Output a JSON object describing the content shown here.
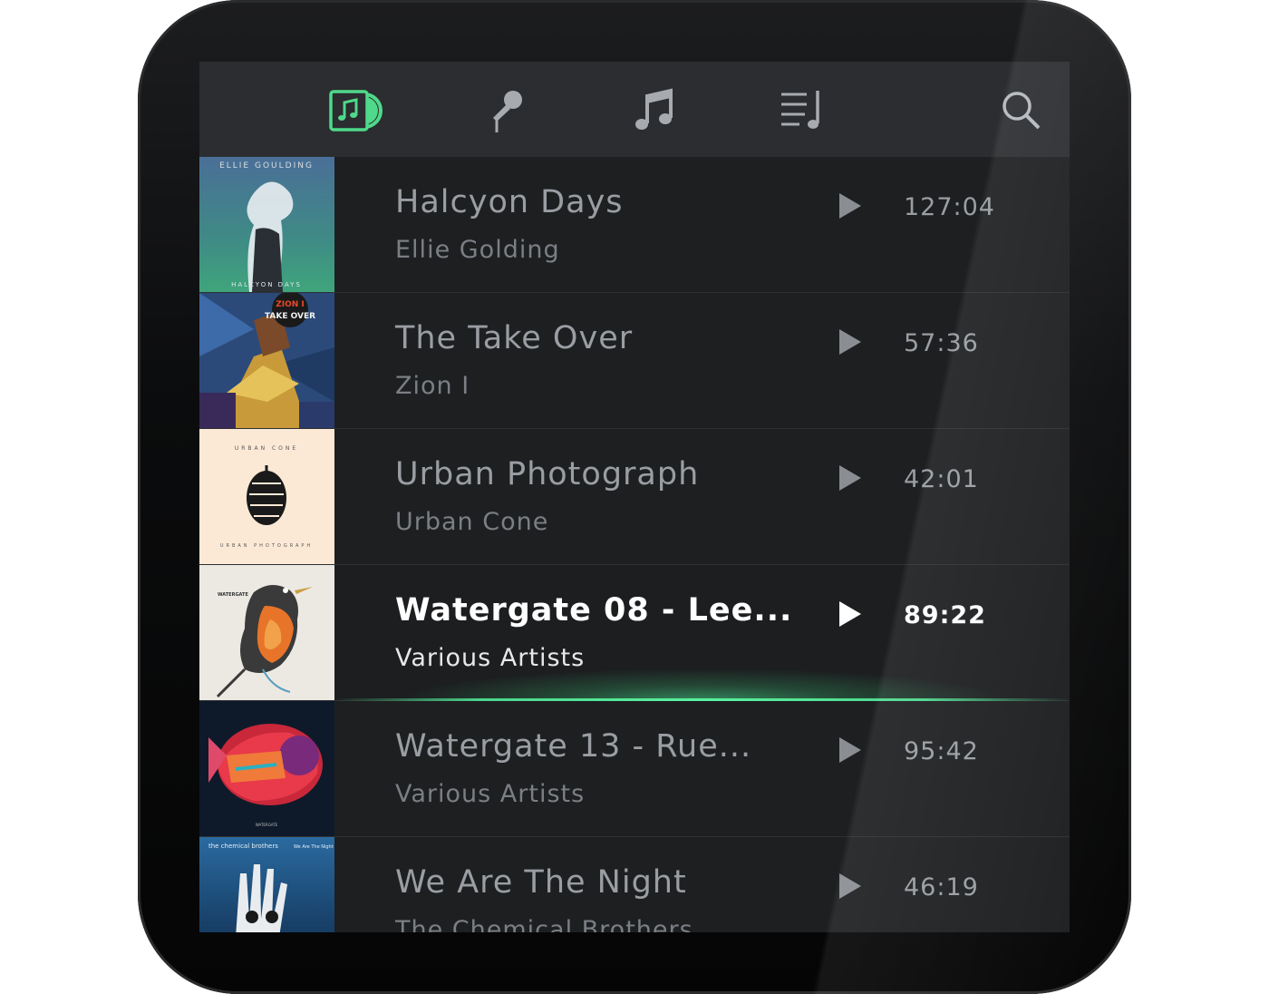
{
  "nav": {
    "tabs": [
      {
        "name": "albums",
        "icon": "album-note-icon",
        "active": true
      },
      {
        "name": "artists",
        "icon": "microphone-icon",
        "active": false
      },
      {
        "name": "songs",
        "icon": "music-note-icon",
        "active": false
      },
      {
        "name": "playlists",
        "icon": "playlist-icon",
        "active": false
      }
    ],
    "search_icon": "search-icon"
  },
  "colors": {
    "accent": "#4fd98a",
    "background": "#1d1f21",
    "navbar": "#2b2d30",
    "text_muted": "#9a9ea3",
    "text_active": "#ffffff"
  },
  "albums": [
    {
      "title": "Halcyon Days",
      "artist": "Ellie Golding",
      "duration": "127:04",
      "art_text": [
        "ELLIE GOULDING",
        "HALCYON DAYS"
      ],
      "active": false
    },
    {
      "title": "The Take Over",
      "artist": "Zion I",
      "duration": "57:36",
      "art_text": [
        "ZION I",
        "TAKE OVER"
      ],
      "active": false
    },
    {
      "title": "Urban Photograph",
      "artist": "Urban Cone",
      "duration": "42:01",
      "art_text": [
        "URBAN CONE",
        "URBAN PHOTOGRAPH"
      ],
      "active": false
    },
    {
      "title": "Watergate 08 - Lee...",
      "artist": "Various Artists",
      "duration": "89:22",
      "art_text": [
        "WATERGATE"
      ],
      "active": true
    },
    {
      "title": "Watergate 13 - Rue...",
      "artist": "Various Artists",
      "duration": "95:42",
      "art_text": [
        "WATERGATE"
      ],
      "active": false
    },
    {
      "title": "We Are The Night",
      "artist": "The Chemical Brothers",
      "duration": "46:19",
      "art_text": [
        "the chemical brothers",
        "We Are The Night"
      ],
      "active": false
    }
  ]
}
